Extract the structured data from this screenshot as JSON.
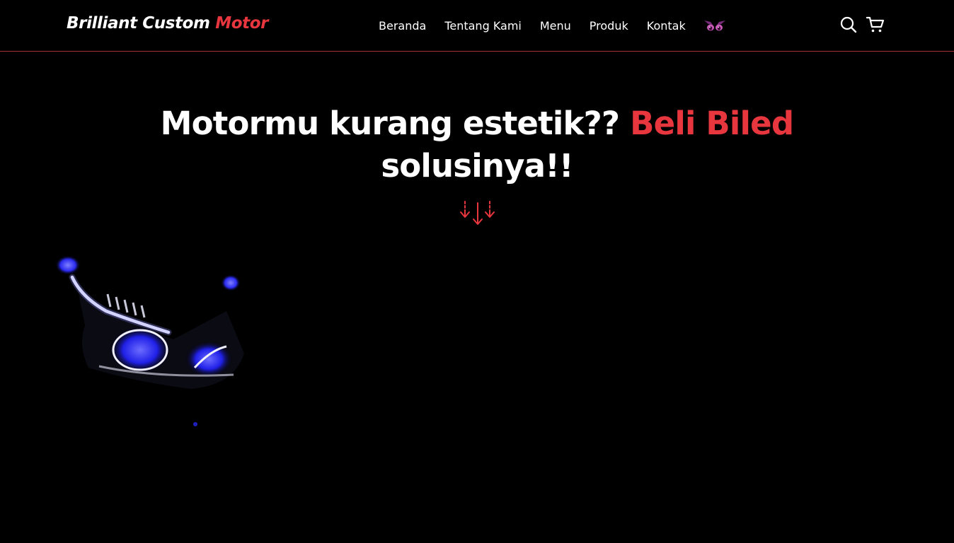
{
  "navbar": {
    "logo_main": "Brilliant Custom ",
    "logo_accent": "Motor",
    "links": [
      {
        "label": "Beranda"
      },
      {
        "label": "Tentang Kami"
      },
      {
        "label": "Menu"
      },
      {
        "label": "Produk"
      },
      {
        "label": "Kontak"
      }
    ],
    "emoji_icon": "devil-eyes-icon",
    "search_icon": "search-icon",
    "cart_icon": "cart-icon"
  },
  "hero": {
    "title_main": "Motormu kurang estetik?? ",
    "title_accent": "Beli Biled",
    "title_end": "solusinya!!",
    "arrows_icon": "down-arrows-icon",
    "image_icon": "motorcycle-headlight-image"
  },
  "colors": {
    "background": "#000000",
    "accent": "#e8363f",
    "divider": "#a8323a",
    "text": "#ffffff"
  }
}
